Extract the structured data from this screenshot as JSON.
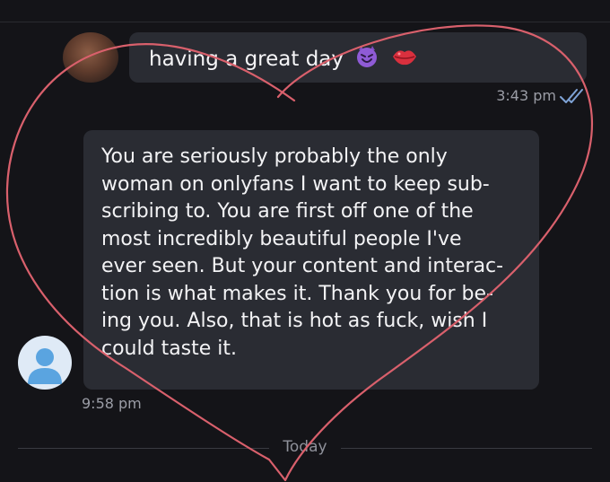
{
  "thread": {
    "sent_message": {
      "text": "having a great day",
      "emojis": [
        "smiling-devil-emoji",
        "lips-emoji"
      ],
      "time": "3:43 pm",
      "status": "double-check-icon"
    },
    "received_message": {
      "lines": [
        "You are seriously probably the only",
        "woman on onlyfans I want to keep sub-",
        "scribing to. You are first off one of the",
        "most incredibly beautiful people I've",
        "ever seen. But your content and interac-",
        "tion is what makes it. Thank you for be-",
        "ing you. Also, that is hot as fuck, wish I",
        "could taste it."
      ],
      "time": "9:58 pm"
    },
    "date_separator": "Today"
  },
  "colors": {
    "background": "#141418",
    "bubble": "#2a2c33",
    "meta_text": "#9b9da6",
    "heart_stroke": "#d9606c",
    "read_check": "#7fa3d6",
    "default_avatar": "#5aa4e0"
  }
}
